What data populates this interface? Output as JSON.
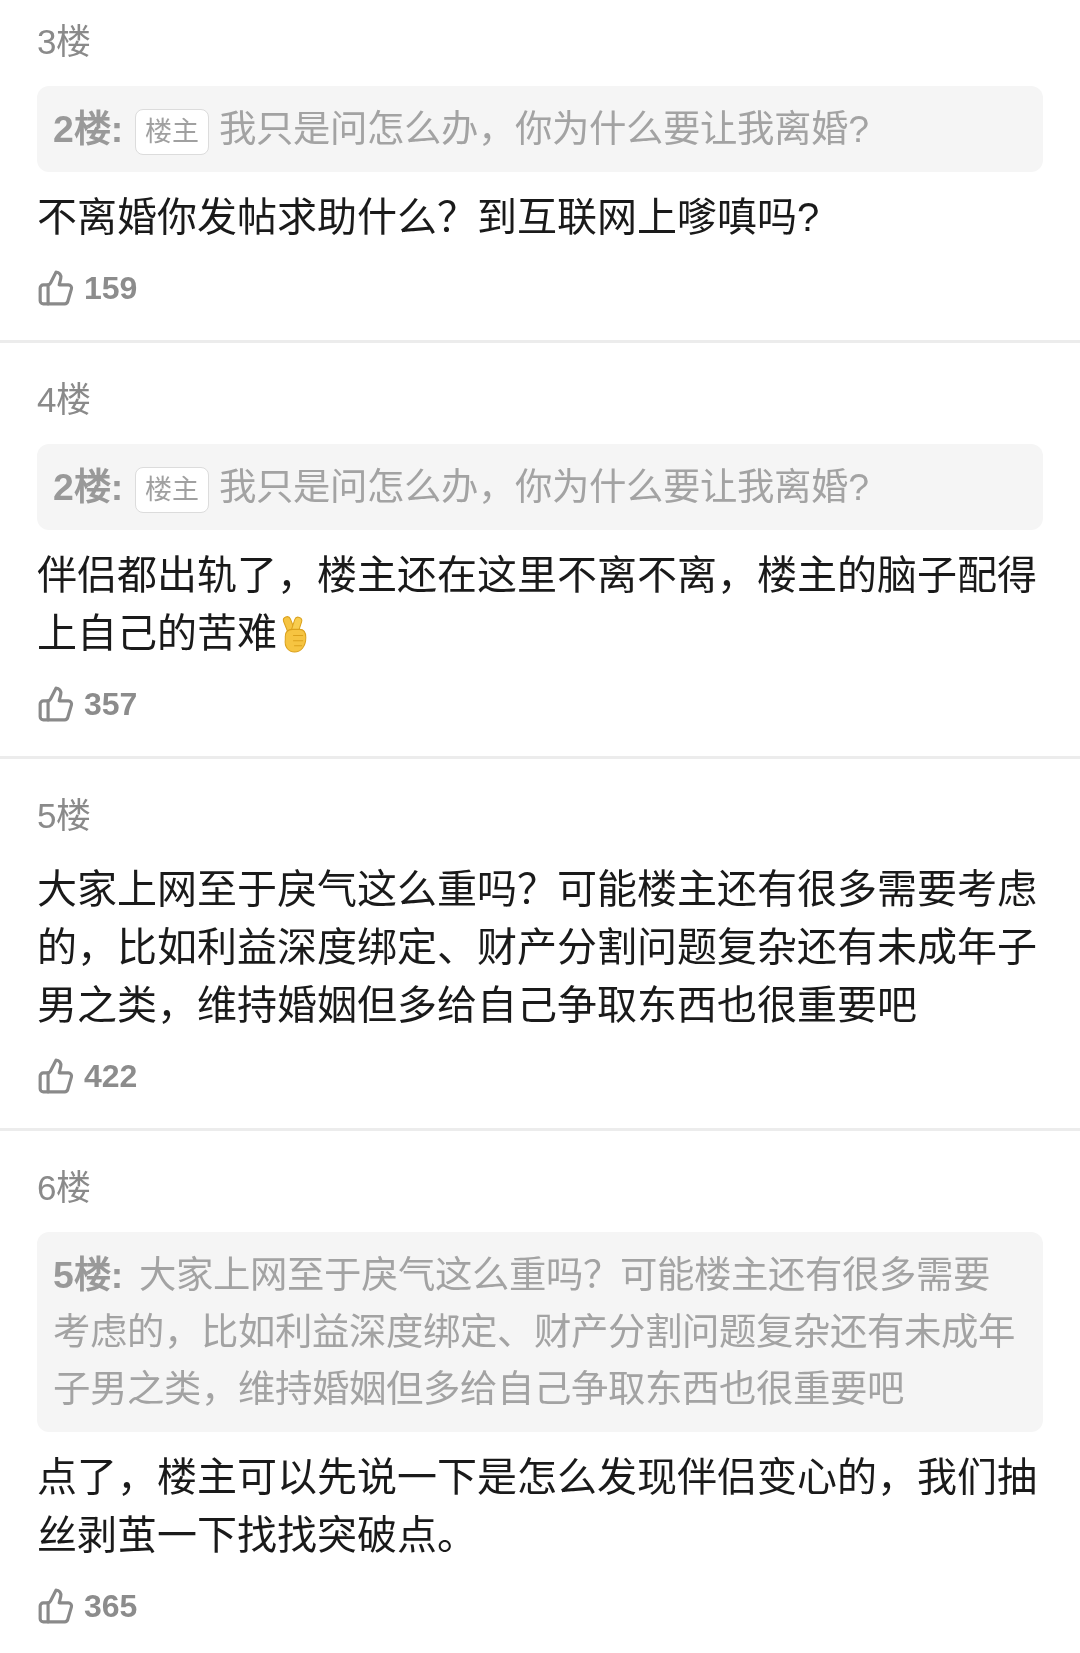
{
  "comments": [
    {
      "floor": "3楼",
      "quote": {
        "floor": "2楼:",
        "badge": "楼主",
        "text": "我只是问怎么办，你为什么要让我离婚?"
      },
      "text": "不离婚你发帖求助什么？到互联网上嗲嗔吗?",
      "trailing_emoji": false,
      "likes": "159"
    },
    {
      "floor": "4楼",
      "quote": {
        "floor": "2楼:",
        "badge": "楼主",
        "text": "我只是问怎么办，你为什么要让我离婚?"
      },
      "text": "伴侣都出轨了，楼主还在这里不离不离，楼主的脑子配得上自己的苦难",
      "trailing_emoji": true,
      "likes": "357"
    },
    {
      "floor": "5楼",
      "text": "大家上网至于戾气这么重吗？可能楼主还有很多需要考虑的，比如利益深度绑定、财产分割问题复杂还有未成年子男之类，维持婚姻但多给自己争取东西也很重要吧",
      "trailing_emoji": false,
      "likes": "422"
    },
    {
      "floor": "6楼",
      "quote": {
        "floor": "5楼:",
        "text": "大家上网至于戾气这么重吗？可能楼主还有很多需要考虑的，比如利益深度绑定、财产分割问题复杂还有未成年子男之类，维持婚姻但多给自己争取东西也很重要吧"
      },
      "text": "点了，楼主可以先说一下是怎么发现伴侣变心的，我们抽丝剥茧一下找找突破点。",
      "trailing_emoji": false,
      "likes": "365"
    }
  ]
}
